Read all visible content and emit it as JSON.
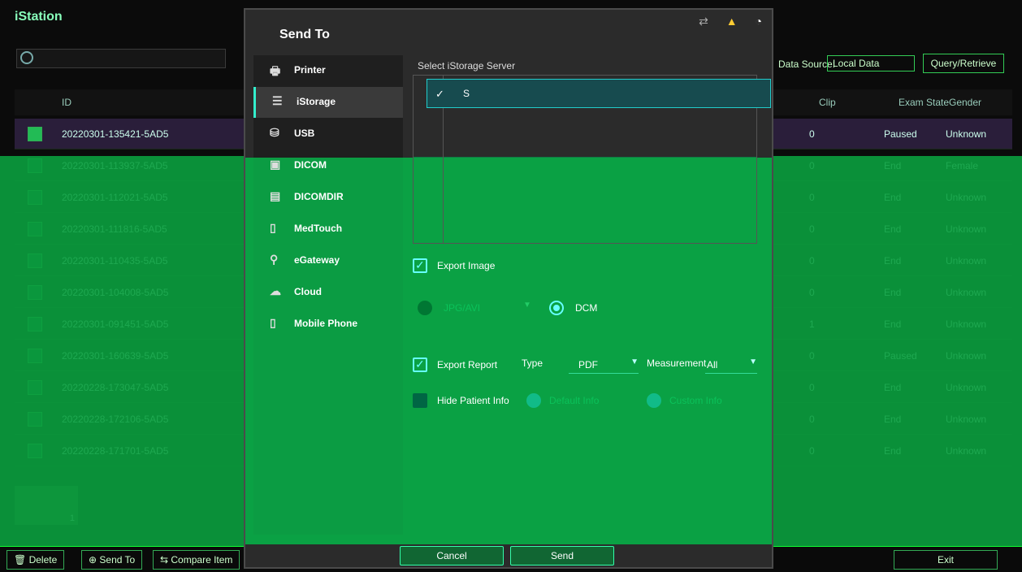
{
  "app": {
    "title": "iStation"
  },
  "search": {
    "placeholder": ""
  },
  "data_source": {
    "label": "Data Source:",
    "value": "Local Data",
    "query_button": "Query/Retrieve"
  },
  "table": {
    "headers": {
      "id": "ID",
      "clip": "Clip",
      "exam_state": "Exam State",
      "gender": "Gender"
    },
    "rows": [
      {
        "id": "20220301-135421-5AD5",
        "clip": "0",
        "state": "Paused",
        "gender": "Unknown"
      },
      {
        "id": "20220301-113937-5AD5",
        "clip": "0",
        "state": "End",
        "gender": "Female"
      },
      {
        "id": "20220301-112021-5AD5",
        "clip": "0",
        "state": "End",
        "gender": "Unknown"
      },
      {
        "id": "20220301-111816-5AD5",
        "clip": "0",
        "state": "End",
        "gender": "Unknown"
      },
      {
        "id": "20220301-110435-5AD5",
        "clip": "0",
        "state": "End",
        "gender": "Unknown"
      },
      {
        "id": "20220301-104008-5AD5",
        "clip": "0",
        "state": "End",
        "gender": "Unknown"
      },
      {
        "id": "20220301-091451-5AD5",
        "clip": "1",
        "state": "End",
        "gender": "Unknown"
      },
      {
        "id": "20220301-160639-5AD5",
        "clip": "0",
        "state": "Paused",
        "gender": "Unknown"
      },
      {
        "id": "20220228-173047-5AD5",
        "clip": "0",
        "state": "End",
        "gender": "Unknown"
      },
      {
        "id": "20220228-172106-5AD5",
        "clip": "0",
        "state": "End",
        "gender": "Unknown"
      },
      {
        "id": "20220228-171701-5AD5",
        "clip": "0",
        "state": "End",
        "gender": "Unknown"
      }
    ]
  },
  "thumb": {
    "count": "1"
  },
  "bottombar": {
    "delete": "Delete",
    "send_to": "Send To",
    "compare": "Compare Item",
    "exit": "Exit"
  },
  "dialog": {
    "title": "Send To",
    "nav": [
      "Printer",
      "iStorage",
      "USB",
      "DICOM",
      "DICOMDIR",
      "MedTouch",
      "eGateway",
      "Cloud",
      "Mobile Phone"
    ],
    "server_label": "Select iStorage Server",
    "server_name": "S",
    "export_image": "Export Image",
    "fmt_jpg": "JPG/AVI",
    "fmt_dcm": "DCM",
    "export_report": "Export Report",
    "type_label": "Type",
    "type_value": "PDF",
    "measurement_label": "Measurement",
    "measurement_value": "All",
    "hide_patient": "Hide Patient Info",
    "default_info": "Default Info",
    "custom_info": "Custom Info",
    "cancel": "Cancel",
    "send": "Send"
  }
}
